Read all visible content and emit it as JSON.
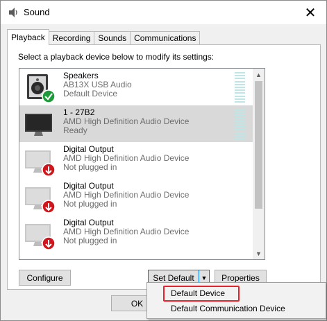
{
  "window": {
    "title": "Sound",
    "close_symbol": "✕"
  },
  "tabs": [
    {
      "label": "Playback",
      "active": true
    },
    {
      "label": "Recording",
      "active": false
    },
    {
      "label": "Sounds",
      "active": false
    },
    {
      "label": "Communications",
      "active": false
    }
  ],
  "instructions": "Select a playback device below to modify its settings:",
  "devices": [
    {
      "name": "Speakers",
      "driver": "AB13X USB Audio",
      "status": "Default Device",
      "icon": "speaker-icon",
      "badge": "check-badge-icon",
      "selected": false
    },
    {
      "name": "1 - 27B2",
      "driver": "AMD High Definition Audio Device",
      "status": "Ready",
      "icon": "monitor-icon",
      "badge": "",
      "selected": true
    },
    {
      "name": "Digital Output",
      "driver": "AMD High Definition Audio Device",
      "status": "Not plugged in",
      "icon": "monitor-icon",
      "badge": "unplugged-badge-icon",
      "selected": false
    },
    {
      "name": "Digital Output",
      "driver": "AMD High Definition Audio Device",
      "status": "Not plugged in",
      "icon": "monitor-icon",
      "badge": "unplugged-badge-icon",
      "selected": false
    },
    {
      "name": "Digital Output",
      "driver": "AMD High Definition Audio Device",
      "status": "Not plugged in",
      "icon": "monitor-icon",
      "badge": "unplugged-badge-icon",
      "selected": false
    }
  ],
  "buttons": {
    "configure": "Configure",
    "set_default": "Set Default",
    "properties": "Properties",
    "ok": "OK"
  },
  "dropdown": {
    "items": [
      "Default Device",
      "Default Communication Device"
    ],
    "highlighted": "Default Device"
  },
  "colors": {
    "check_badge": "#1e9a3a",
    "unplugged_badge": "#d0161c",
    "meter": "#bfe6e6",
    "highlight": "#e8222a",
    "focus": "#0078d7"
  }
}
